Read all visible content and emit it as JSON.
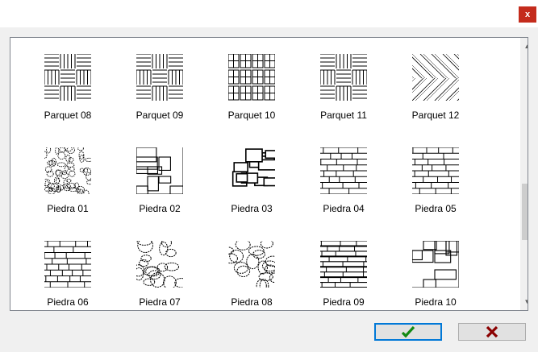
{
  "window": {
    "close_label": "x"
  },
  "patterns": [
    {
      "label": "Parquet 08",
      "icon": "parquet-basketweave-pattern"
    },
    {
      "label": "Parquet 09",
      "icon": "parquet-basketweave-pattern"
    },
    {
      "label": "Parquet 10",
      "icon": "parquet-grid-pattern"
    },
    {
      "label": "Parquet 11",
      "icon": "parquet-basketweave-pattern"
    },
    {
      "label": "Parquet 12",
      "icon": "parquet-herringbone-pattern"
    },
    {
      "label": "Piedra 01",
      "icon": "stone-pebble-pattern"
    },
    {
      "label": "Piedra 02",
      "icon": "stone-block-pattern"
    },
    {
      "label": "Piedra 03",
      "icon": "stone-flagstone-pattern"
    },
    {
      "label": "Piedra 04",
      "icon": "stone-brick-pattern"
    },
    {
      "label": "Piedra 05",
      "icon": "stone-brick-pattern"
    },
    {
      "label": "Piedra 06",
      "icon": "stone-brick-pattern"
    },
    {
      "label": "Piedra 07",
      "icon": "stone-cobble-pattern"
    },
    {
      "label": "Piedra 08",
      "icon": "stone-cobble-pattern"
    },
    {
      "label": "Piedra 09",
      "icon": "stone-ashlar-pattern"
    },
    {
      "label": "Piedra 10",
      "icon": "stone-block-pattern"
    }
  ],
  "buttons": {
    "ok_icon": "checkmark-icon",
    "ok_color": "#138a13",
    "cancel_icon": "cross-icon",
    "cancel_color": "#8b0000"
  }
}
